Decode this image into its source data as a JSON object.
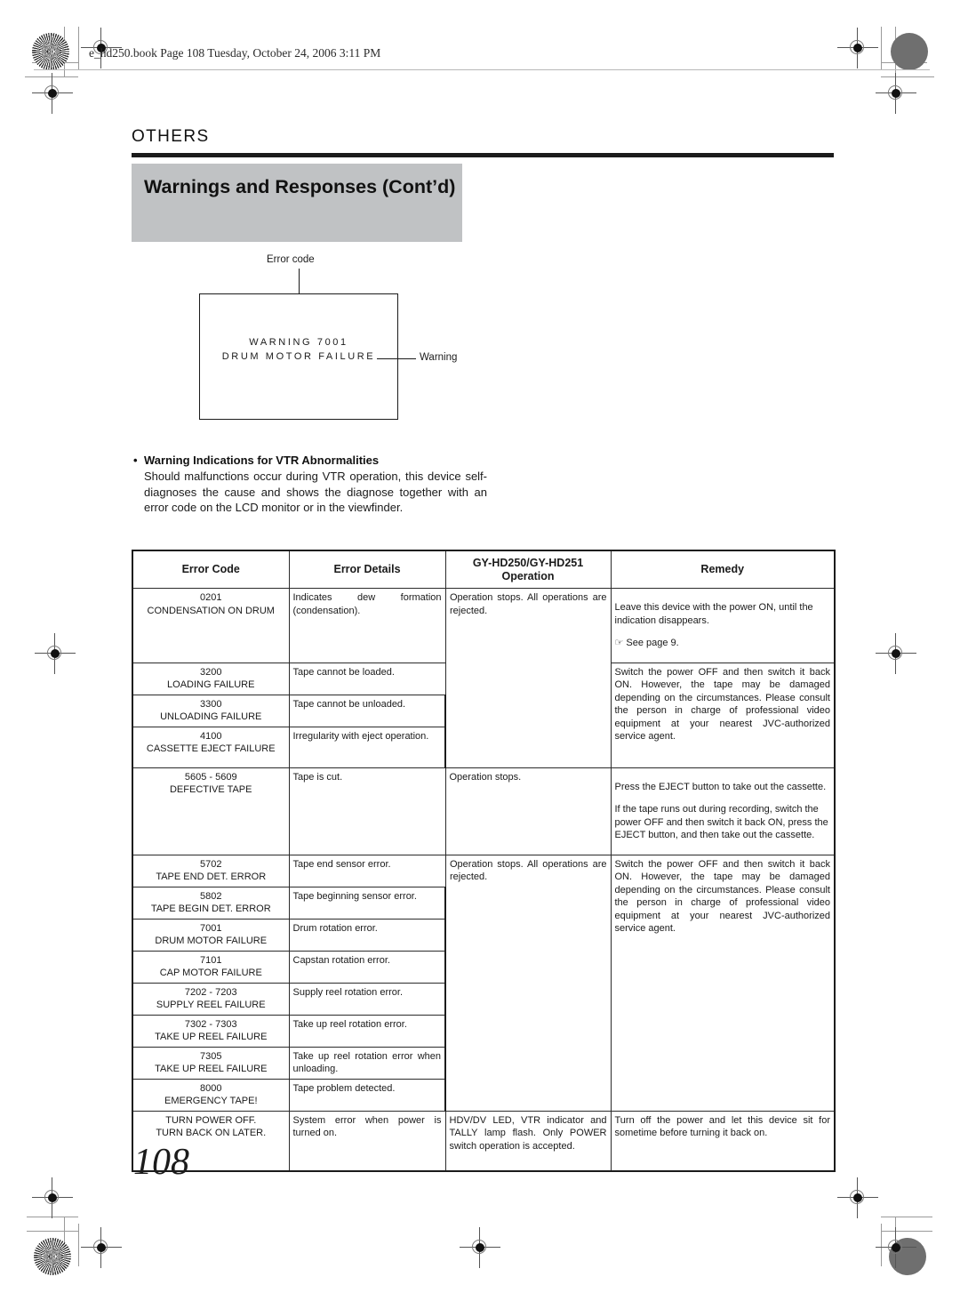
{
  "printing": {
    "header_line": "e_hd250.book  Page 108  Tuesday, October 24, 2006  3:11 PM"
  },
  "section": {
    "label": "OTHERS",
    "title": "Warnings and Responses (Cont’d)"
  },
  "figure": {
    "label_error_code": "Error code",
    "label_warning": "Warning",
    "vf_line1": "WARNING 7001",
    "vf_line2": "DRUM MOTOR FAILURE"
  },
  "bullet": {
    "heading": "Warning Indications for VTR Abnormalities",
    "body": "Should malfunctions occur during VTR operation, this device self-diagnoses the cause and shows the diagnose together with an error code on the LCD monitor or in the viewfinder."
  },
  "table": {
    "headers": {
      "col1": "Error Code",
      "col2": "Error Details",
      "col3_line1": "GY-HD250/GY-HD251",
      "col3_line2": "Operation",
      "col4": "Remedy"
    },
    "rows": [
      {
        "code": "0201",
        "name": "CONDENSATION ON DRUM",
        "details": "Indicates dew formation (condensation).",
        "operation": "Operation stops. All operations are rejected.",
        "remedy_lines": [
          "Leave this device with the power ON, until the indication disappears."
        ],
        "remedy_see_page": "See page 9.",
        "see_page_icon": "pointing-hand-icon"
      },
      {
        "code": "3200",
        "name": "LOADING FAILURE",
        "details": "Tape cannot be loaded."
      },
      {
        "code": "3300",
        "name": "UNLOADING FAILURE",
        "details": "Tape cannot be unloaded."
      },
      {
        "code": "4100",
        "name": "CASSETTE EJECT FAILURE",
        "details": "Irregularity with eject operation.",
        "remedy_group": "Switch the power OFF and then switch it back ON. However, the tape may be damaged depending on the circumstances. Please consult the person in charge of professional video equipment at your nearest JVC-authorized service agent."
      },
      {
        "code": "5605 - 5609",
        "name": "DEFECTIVE TAPE",
        "details": "Tape is cut.",
        "operation": "Operation stops.",
        "remedy_lines": [
          "Press the EJECT button to take out the cassette.",
          "If the tape runs out during recording, switch the power OFF and then switch it back ON, press the EJECT button, and then take out the cassette."
        ]
      },
      {
        "code": "5702",
        "name": "TAPE END DET. ERROR",
        "details": "Tape end sensor error.",
        "operation": "Operation stops. All operations are rejected.",
        "remedy_group": "Switch the power OFF and then switch it back ON. However, the tape may be damaged depending on the circumstances. Please consult the person in charge of professional video equipment at your nearest JVC-authorized service agent."
      },
      {
        "code": "5802",
        "name": "TAPE BEGIN DET. ERROR",
        "details": "Tape beginning sensor error."
      },
      {
        "code": "7001",
        "name": "DRUM MOTOR FAILURE",
        "details": "Drum rotation error."
      },
      {
        "code": "7101",
        "name": "CAP MOTOR FAILURE",
        "details": "Capstan rotation error."
      },
      {
        "code": "7202 - 7203",
        "name": "SUPPLY REEL FAILURE",
        "details": "Supply reel rotation error."
      },
      {
        "code": "7302 - 7303",
        "name": "TAKE UP REEL FAILURE",
        "details": "Take up reel rotation error."
      },
      {
        "code": "7305",
        "name": "TAKE UP REEL FAILURE",
        "details": "Take up reel rotation error when unloading."
      },
      {
        "code": "8000",
        "name": "EMERGENCY TAPE!",
        "details": "Tape problem detected."
      },
      {
        "code": "TURN POWER OFF.",
        "name": "TURN BACK ON LATER.",
        "details": "System error when power is turned on.",
        "operation": "HDV/DV LED, VTR indicator and TALLY lamp flash. Only POWER switch operation is accepted.",
        "remedy_lines": [
          "Turn off the power and let this device sit for sometime before turning it back on."
        ]
      }
    ]
  },
  "footer": {
    "page_number": "108"
  }
}
